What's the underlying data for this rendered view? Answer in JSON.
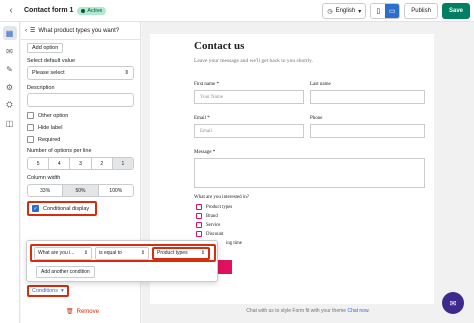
{
  "topbar": {
    "title": "Contact form 1",
    "status": "Active",
    "language": "English",
    "publish_label": "Publish",
    "save_label": "Save",
    "back_icon": "chevron-left-icon",
    "status_color": "#aee9d1"
  },
  "rail": {
    "icons": [
      "form-icon",
      "inbox-icon",
      "brush-icon",
      "integration-icon",
      "gear-icon",
      "app-icon"
    ]
  },
  "panel": {
    "header_label": "What product types you want?",
    "add_option_label": "Add option",
    "default_label": "Select default value",
    "default_value": "Please select",
    "description_label": "Description",
    "other_option_label": "Other option",
    "hide_label_label": "Hide label",
    "required_label": "Required",
    "options_per_line_label": "Number of options per line",
    "options_per_line": [
      "5",
      "4",
      "3",
      "2",
      "1"
    ],
    "options_per_line_selected": "1",
    "column_width_label": "Column width",
    "column_widths": [
      "33%",
      "50%",
      "100%"
    ],
    "column_width_selected": "50%",
    "conditional_display_label": "Conditional display",
    "conditions_label": "Conditions",
    "remove_label": "Remove"
  },
  "popover": {
    "field": "What are you i...",
    "operator": "is equal to",
    "value": "Product types",
    "add_condition_label": "Add another condition"
  },
  "form": {
    "title": "Contact us",
    "subtitle": "Leave your message and we'll get back to you shortly.",
    "first_name_label": "First name *",
    "first_name_placeholder": "Your Name",
    "last_name_label": "Last name",
    "email_label": "Email *",
    "email_placeholder": "Email",
    "phone_label": "Phone",
    "message_label": "Message *",
    "interest_label": "What are you interested in?",
    "interest_options": [
      "Product types",
      "Brand",
      "Service",
      "Discount"
    ],
    "partial_option_text": "ing time",
    "accent_color": "#e0115f"
  },
  "footer": {
    "note": "Chat with us to style Form fit with your theme",
    "link": "Chat now."
  }
}
